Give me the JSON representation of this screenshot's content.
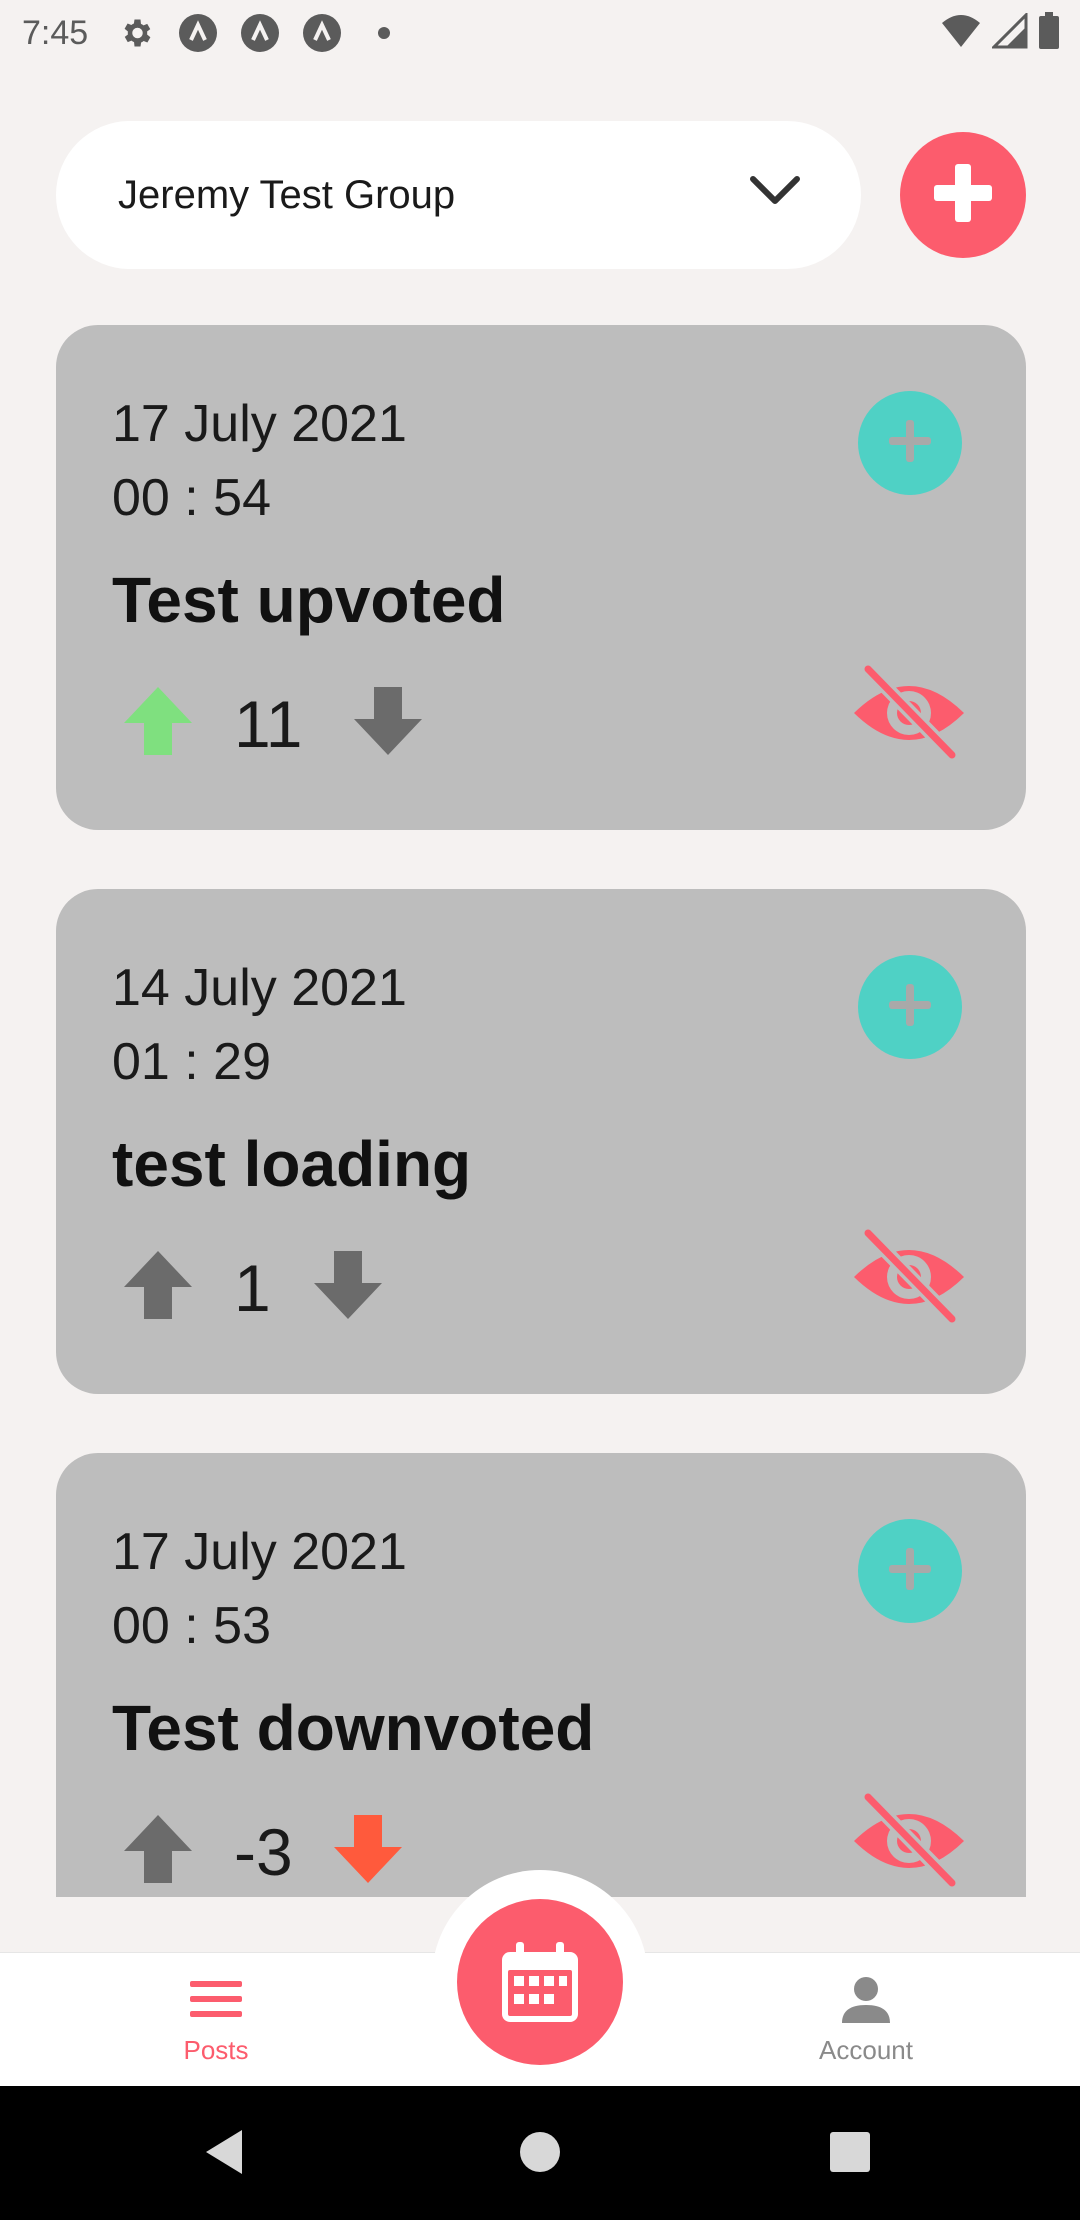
{
  "status_bar": {
    "time": "7:45"
  },
  "group_selector": {
    "selected": "Jeremy Test Group"
  },
  "posts": [
    {
      "date": "17 July 2021",
      "time": "00 : 54",
      "title": "Test upvoted",
      "votes": "11",
      "vote_state": "up"
    },
    {
      "date": "14 July 2021",
      "time": "01 : 29",
      "title": "test loading",
      "votes": "1",
      "vote_state": "none"
    },
    {
      "date": "17 July 2021",
      "time": "00 : 53",
      "title": "Test downvoted",
      "votes": "-3",
      "vote_state": "down"
    }
  ],
  "bottom_nav": {
    "posts_label": "Posts",
    "account_label": "Account"
  },
  "colors": {
    "accent": "#fc5c6d",
    "teal": "#4fd1c5",
    "upvote_active": "#7fe07f",
    "downvote_active": "#ff5a3c",
    "vote_inactive": "#6b6b6b",
    "card_bg": "#bdbdbd"
  },
  "icons": {
    "settings": "gear-icon",
    "notification": "app-notification-icon",
    "wifi": "wifi-icon",
    "signal": "signal-icon",
    "battery": "battery-icon",
    "dropdown": "chevron-down-icon",
    "add": "plus-icon",
    "hide": "eye-off-icon",
    "upvote": "arrow-up-icon",
    "downvote": "arrow-down-icon",
    "posts": "menu-icon",
    "calendar": "calendar-icon",
    "account": "person-icon"
  }
}
